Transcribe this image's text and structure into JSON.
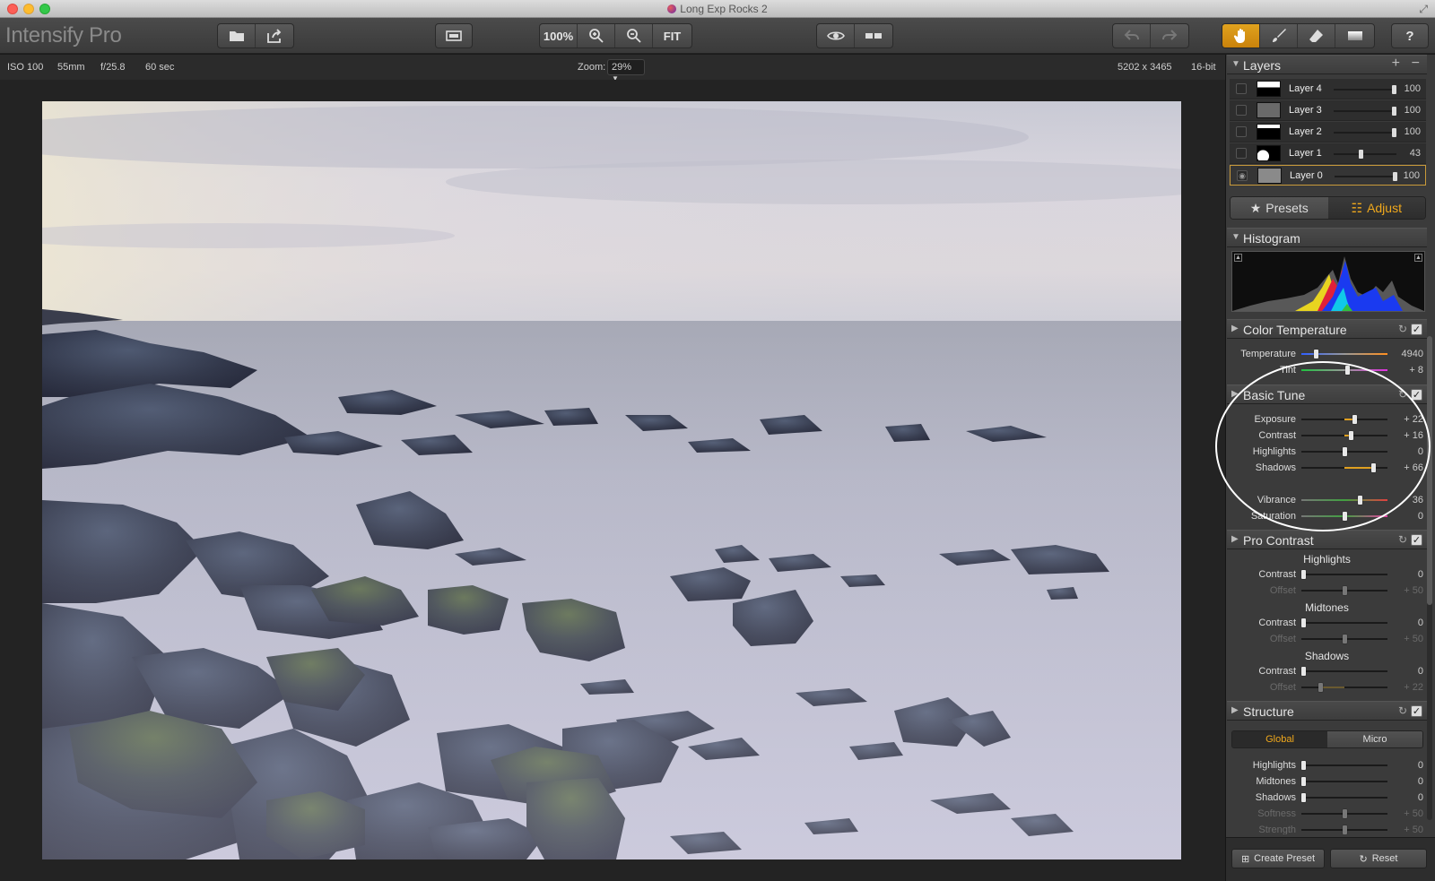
{
  "window": {
    "title": "Long Exp Rocks 2"
  },
  "app": {
    "name": "Intensify Pro"
  },
  "toolbar": {
    "zoom_100": "100%",
    "fit": "FIT"
  },
  "info": {
    "iso": "ISO 100",
    "focal": "55mm",
    "aperture": "f/25.8",
    "shutter": "60  sec",
    "zoom_label": "Zoom:",
    "zoom_value": "29%",
    "dimensions": "5202 x 3465",
    "bitdepth": "16-bit"
  },
  "layers": {
    "title": "Layers",
    "items": [
      {
        "name": "Layer 4",
        "value": "100",
        "opacity": 1.0
      },
      {
        "name": "Layer 3",
        "value": "100",
        "opacity": 1.0
      },
      {
        "name": "Layer 2",
        "value": "100",
        "opacity": 1.0
      },
      {
        "name": "Layer 1",
        "value": "43",
        "opacity": 0.43
      },
      {
        "name": "Layer 0",
        "value": "100",
        "opacity": 1.0
      }
    ]
  },
  "tabs": {
    "presets": "Presets",
    "adjust": "Adjust"
  },
  "histogram": {
    "title": "Histogram"
  },
  "color_temperature": {
    "title": "Color Temperature",
    "temperature_label": "Temperature",
    "temperature_value": "4940",
    "tint_label": "Tint",
    "tint_value": "+ 8"
  },
  "basic_tune": {
    "title": "Basic Tune",
    "exposure_label": "Exposure",
    "exposure_value": "+ 22",
    "contrast_label": "Contrast",
    "contrast_value": "+ 16",
    "highlights_label": "Highlights",
    "highlights_value": "0",
    "shadows_label": "Shadows",
    "shadows_value": "+ 66",
    "vibrance_label": "Vibrance",
    "vibrance_value": "36",
    "saturation_label": "Saturation",
    "saturation_value": "0"
  },
  "pro_contrast": {
    "title": "Pro Contrast",
    "highlights_head": "Highlights",
    "midtones_head": "Midtones",
    "shadows_head": "Shadows",
    "contrast_label": "Contrast",
    "offset_label": "Offset",
    "h_contrast": "0",
    "h_offset": "+ 50",
    "m_contrast": "0",
    "m_offset": "+ 50",
    "s_contrast": "0",
    "s_offset": "+ 22"
  },
  "structure": {
    "title": "Structure",
    "global_label": "Global",
    "micro_label": "Micro",
    "highlights_label": "Highlights",
    "highlights_value": "0",
    "midtones_label": "Midtones",
    "midtones_value": "0",
    "shadows_label": "Shadows",
    "shadows_value": "0",
    "softness_label": "Softness",
    "softness_value": "+ 50",
    "strength_label": "Strength",
    "strength_value": "+ 50"
  },
  "footer": {
    "create_preset": "Create Preset",
    "reset": "Reset"
  },
  "colors": {
    "accent": "#f0a81c",
    "panel": "#3b3b3b"
  }
}
